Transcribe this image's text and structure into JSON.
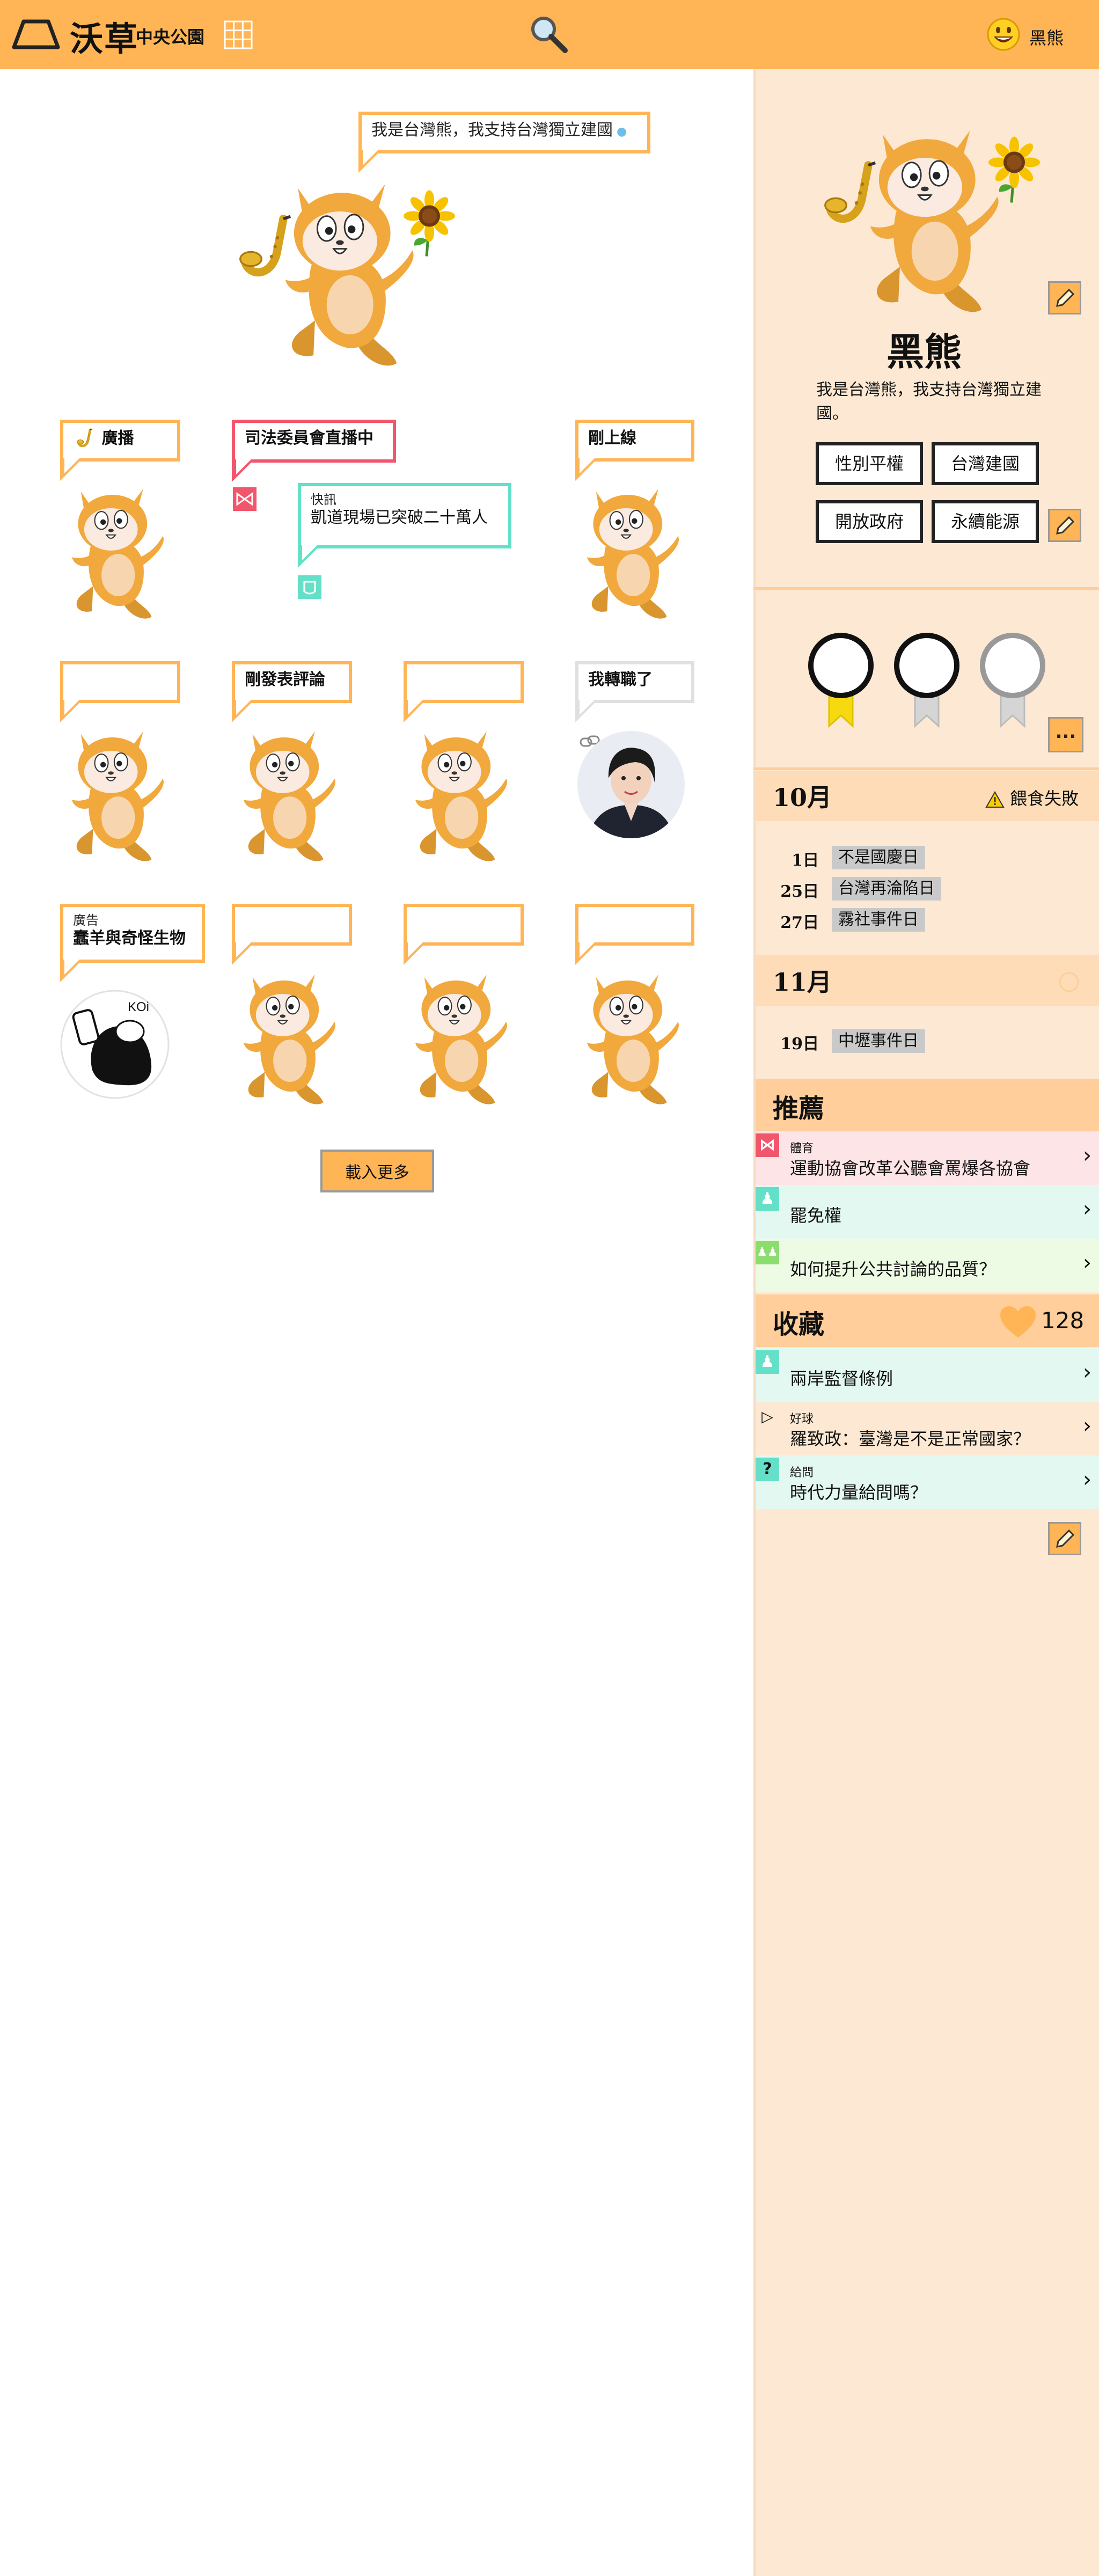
{
  "app": {
    "title": "沃草",
    "subtitle": "中央公園"
  },
  "user": {
    "name": "黑熊"
  },
  "colors": {
    "accent": "#ffb555",
    "sidebar": "#fde9d3",
    "red": "#f2566c",
    "teal": "#64e0c8"
  },
  "hero": {
    "bubble": "我是台灣熊，我支持台灣獨立建國"
  },
  "feed": [
    {
      "label": "廣播"
    },
    {
      "label": "司法委員會直播中"
    },
    {
      "kind": "快訊",
      "label": "凱道現場已突破二十萬人"
    },
    {
      "label": "剛上線"
    },
    {
      "label": ""
    },
    {
      "label": "剛發表評論"
    },
    {
      "label": ""
    },
    {
      "label": "我轉職了"
    },
    {
      "kind": "廣告",
      "label": "蠢羊與奇怪生物"
    },
    {
      "label": ""
    },
    {
      "label": ""
    },
    {
      "label": ""
    }
  ],
  "ad_image_text": "KOi",
  "load_more": "載入更多",
  "profile": {
    "name": "黑熊",
    "bio": "我是台灣熊，我支持台灣獨立建國。",
    "tags": [
      "性別平權",
      "台灣建國",
      "開放政府",
      "永續能源"
    ]
  },
  "medals": [
    "gold",
    "silver",
    "silver"
  ],
  "more_label": "...",
  "calendar": [
    {
      "month": "10月",
      "alert": "餵食失敗",
      "events": [
        {
          "day": "1日",
          "name": "不是國慶日"
        },
        {
          "day": "25日",
          "name": "台灣再淪陷日"
        },
        {
          "day": "27日",
          "name": "霧社事件日"
        }
      ]
    },
    {
      "month": "11月",
      "alert": "",
      "events": [
        {
          "day": "19日",
          "name": "中壢事件日"
        }
      ]
    }
  ],
  "recommend": {
    "title": "推薦",
    "items": [
      {
        "category": "體育",
        "title": "運動協會改革公聽會罵爆各協會",
        "icon": "bowtie-icon",
        "color": "#f2566c"
      },
      {
        "category": "",
        "title": "罷免權",
        "icon": "person-icon",
        "color": "#64e0c8"
      },
      {
        "category": "",
        "title": "如何提升公共討論的品質？",
        "icon": "people-icon",
        "color": "#8bdd6e"
      }
    ]
  },
  "favorites": {
    "title": "收藏",
    "count": "128",
    "items": [
      {
        "category": "",
        "title": "兩岸監督條例",
        "icon": "person-icon",
        "color": "#64e0c8"
      },
      {
        "category": "好球",
        "title": "羅致政：臺灣是不是正常國家？",
        "icon": "play-icon",
        "color": "#fde9d3"
      },
      {
        "category": "給問",
        "title": "時代力量給問嗎？",
        "icon": "question-icon",
        "color": "#64e0c8"
      }
    ]
  }
}
